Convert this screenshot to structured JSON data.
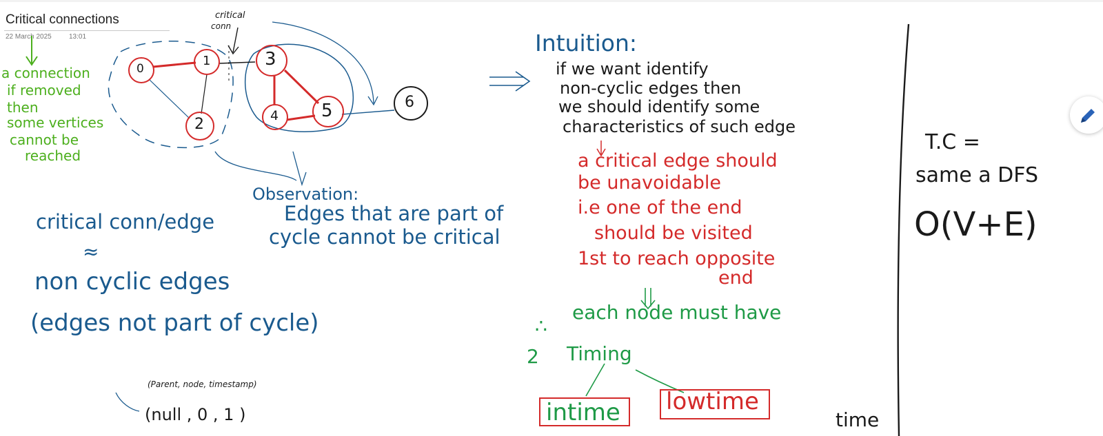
{
  "page": {
    "title": "Critical connections",
    "date": "22 March 2025",
    "time": "13:01"
  },
  "colors": {
    "green": "#4caf1d",
    "blue": "#1a5a8e",
    "black": "#1a1a1a",
    "red": "#d42a2a",
    "dark_green": "#1e9a46"
  },
  "graph": {
    "nodes": [
      "0",
      "1",
      "2",
      "3",
      "4",
      "5",
      "6"
    ],
    "annotation": [
      "critical",
      "conn"
    ]
  },
  "notes": {
    "definition": [
      "a connection",
      "if removed",
      "then",
      "some vertices",
      "cannot be",
      "reached"
    ],
    "critical_edge": "critical conn/edge",
    "equiv_symbol": "≈",
    "non_cyclic": "non cyclic edges",
    "not_part": "(edges not part of cycle)",
    "observation_title": "Observation:",
    "observation_lines": [
      "Edges that are part of",
      "cycle cannot be critical"
    ],
    "intuition_title": "Intuition:",
    "intuition_lines": [
      "if we want identify",
      "non-cyclic edges then",
      "we should identify some",
      "characteristics of such edge"
    ],
    "red_lines": [
      "a critical edge should",
      "be unavoidable",
      "i.e one of the end",
      "should be visited",
      "1st to reach opposite",
      "end"
    ],
    "must_have": "each node must have",
    "therefore_symbol": "∴",
    "timing_prefix": "2",
    "timing": "Timing",
    "intime": "intime",
    "lowtime": "lowtime",
    "tc_label": "T.C =",
    "tc_same": "same a DFS",
    "tc_value": "O(V+E)",
    "tuple_header": "(Parent, node, timestamp)",
    "tuple_values": "(null , 0 , 1 )",
    "cut_word": "time"
  }
}
